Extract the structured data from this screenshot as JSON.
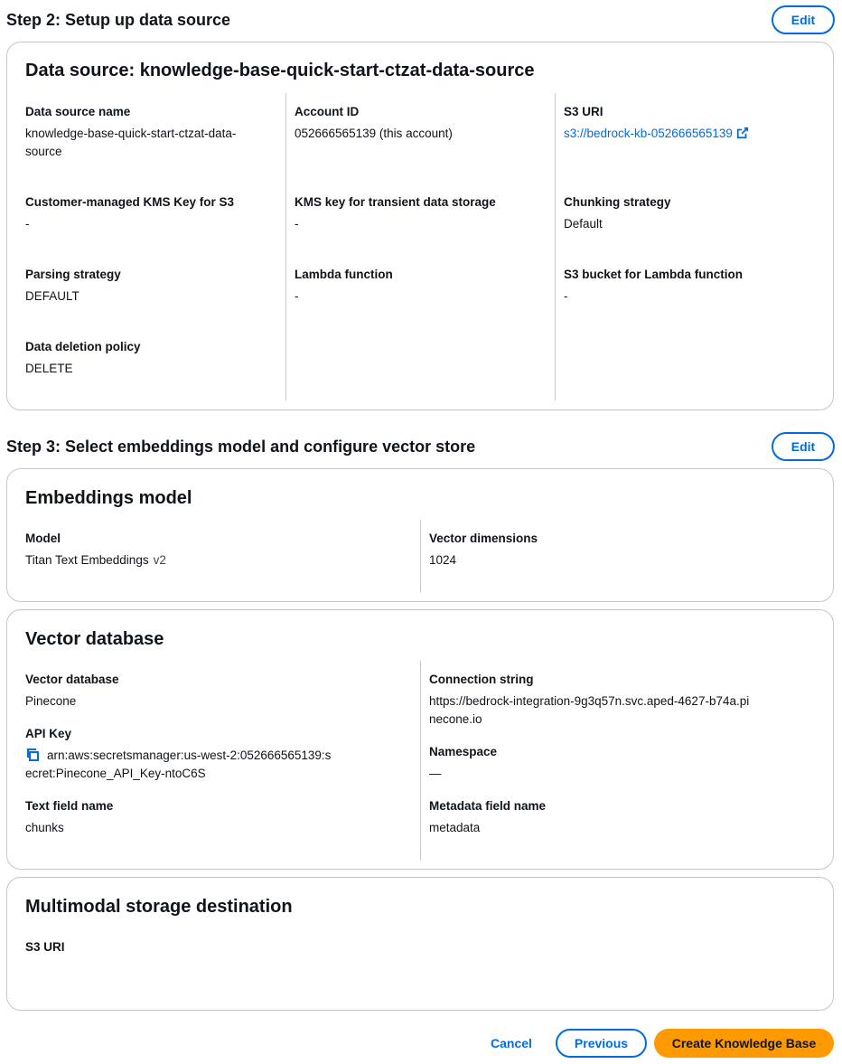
{
  "step2": {
    "title": "Step 2: Setup up data source",
    "edit_label": "Edit",
    "card_title": "Data source: knowledge-base-quick-start-ctzat-data-source",
    "fields": {
      "ds_name_label": "Data source name",
      "ds_name_value": "knowledge-base-quick-start-ctzat-data-source",
      "account_label": "Account ID",
      "account_value": "052666565139 (this account)",
      "s3uri_label": "S3 URI",
      "s3uri_value": "s3://bedrock-kb-052666565139",
      "kms_s3_label": "Customer-managed KMS Key for S3",
      "kms_s3_value": "-",
      "kms_transient_label": "KMS key for transient data storage",
      "kms_transient_value": "-",
      "chunking_label": "Chunking strategy",
      "chunking_value": "Default",
      "parsing_label": "Parsing strategy",
      "parsing_value": "DEFAULT",
      "lambda_label": "Lambda function",
      "lambda_value": "-",
      "s3_lambda_label": "S3 bucket for Lambda function",
      "s3_lambda_value": "-",
      "deletion_label": "Data deletion policy",
      "deletion_value": "DELETE"
    }
  },
  "step3": {
    "title": "Step 3: Select embeddings model and configure vector store",
    "edit_label": "Edit",
    "embeddings": {
      "card_title": "Embeddings model",
      "model_label": "Model",
      "model_value": "Titan Text Embeddings",
      "model_version": "v2",
      "dims_label": "Vector dimensions",
      "dims_value": "1024"
    },
    "vector_db": {
      "card_title": "Vector database",
      "db_label": "Vector database",
      "db_value": "Pinecone",
      "api_key_label": "API Key",
      "api_key_value": "arn:aws:secretsmanager:us-west-2:052666565139:secret:Pinecone_API_Key-ntoC6S",
      "text_field_label": "Text field name",
      "text_field_value": "chunks",
      "conn_label": "Connection string",
      "conn_value": "https://bedrock-integration-9g3q57n.svc.aped-4627-b74a.pinecone.io",
      "namespace_label": "Namespace",
      "namespace_value": "—",
      "metadata_label": "Metadata field name",
      "metadata_value": "metadata"
    },
    "multimodal": {
      "card_title": "Multimodal storage destination",
      "s3uri_label": "S3 URI"
    }
  },
  "footer": {
    "cancel_label": "Cancel",
    "previous_label": "Previous",
    "create_label": "Create Knowledge Base"
  },
  "colors": {
    "link": "#006ce0",
    "primary_button": "#ff9900",
    "border": "#c6c6cd"
  },
  "icons": {
    "external": "external-link-icon",
    "copy": "copy-icon"
  }
}
